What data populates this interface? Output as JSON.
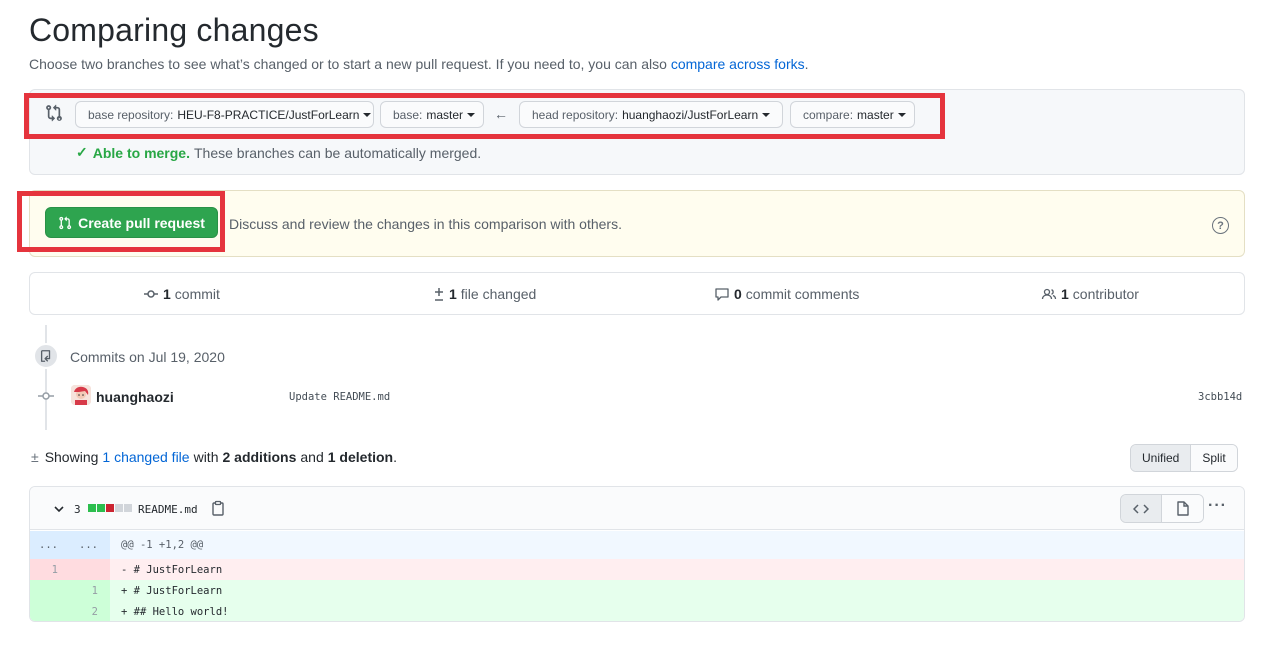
{
  "page": {
    "title": "Comparing changes",
    "subtitle_text": "Choose two branches to see what’s changed or to start a new pull request. If you need to, you can also",
    "subtitle_link": "compare across forks",
    "subtitle_end": "."
  },
  "range": {
    "base_repo_label": "base repository:",
    "base_repo_value": "HEU-F8-PRACTICE/JustForLearn",
    "base_label": "base:",
    "base_value": "master",
    "arrow": "←",
    "head_repo_label": "head repository:",
    "head_repo_value": "huanghaozi/JustForLearn",
    "compare_label": "compare:",
    "compare_value": "master",
    "merge_status": "Able to merge.",
    "merge_detail": "These branches can be automatically merged."
  },
  "pull_request": {
    "button_label": "Create pull request",
    "description": "Discuss and review the changes in this comparison with others.",
    "help_icon": "?"
  },
  "stats": {
    "commits_count": "1",
    "commits_label": "commit",
    "files_count": "1",
    "files_label": "file changed",
    "comments_count": "0",
    "comments_label": "commit comments",
    "contributors_count": "1",
    "contributors_label": "contributor"
  },
  "commits": {
    "date_heading": "Commits on Jul 19, 2020",
    "items": [
      {
        "author": "huanghaozi",
        "message": "Update README.md",
        "sha": "3cbb14d"
      }
    ]
  },
  "summary": {
    "showing": "Showing",
    "changed_files": "1 changed file",
    "with": "with",
    "additions": "2 additions",
    "and": "and",
    "deletions": "1 deletion",
    "period": "."
  },
  "view_toggle": {
    "unified": "Unified",
    "split": "Split",
    "selected": "Unified"
  },
  "file": {
    "change_count": "3",
    "name": "README.md",
    "diffstat": [
      "added",
      "added",
      "deleted",
      "neutral",
      "neutral"
    ],
    "hunk_left": "...",
    "hunk_right": "...",
    "hunk_header": "@@ -1 +1,2 @@",
    "lines": [
      {
        "type": "del",
        "old": "1",
        "new": "",
        "text": "- # JustForLearn"
      },
      {
        "type": "add",
        "old": "",
        "new": "1",
        "text": "+ # JustForLearn"
      },
      {
        "type": "add",
        "old": "",
        "new": "2",
        "text": "+ ## Hello world!"
      }
    ]
  },
  "colors": {
    "primary_button": "#2ea44f",
    "link": "#0366d6",
    "highlight_box": "#e5343d",
    "addition": "#e6ffed",
    "deletion": "#ffeef0"
  }
}
